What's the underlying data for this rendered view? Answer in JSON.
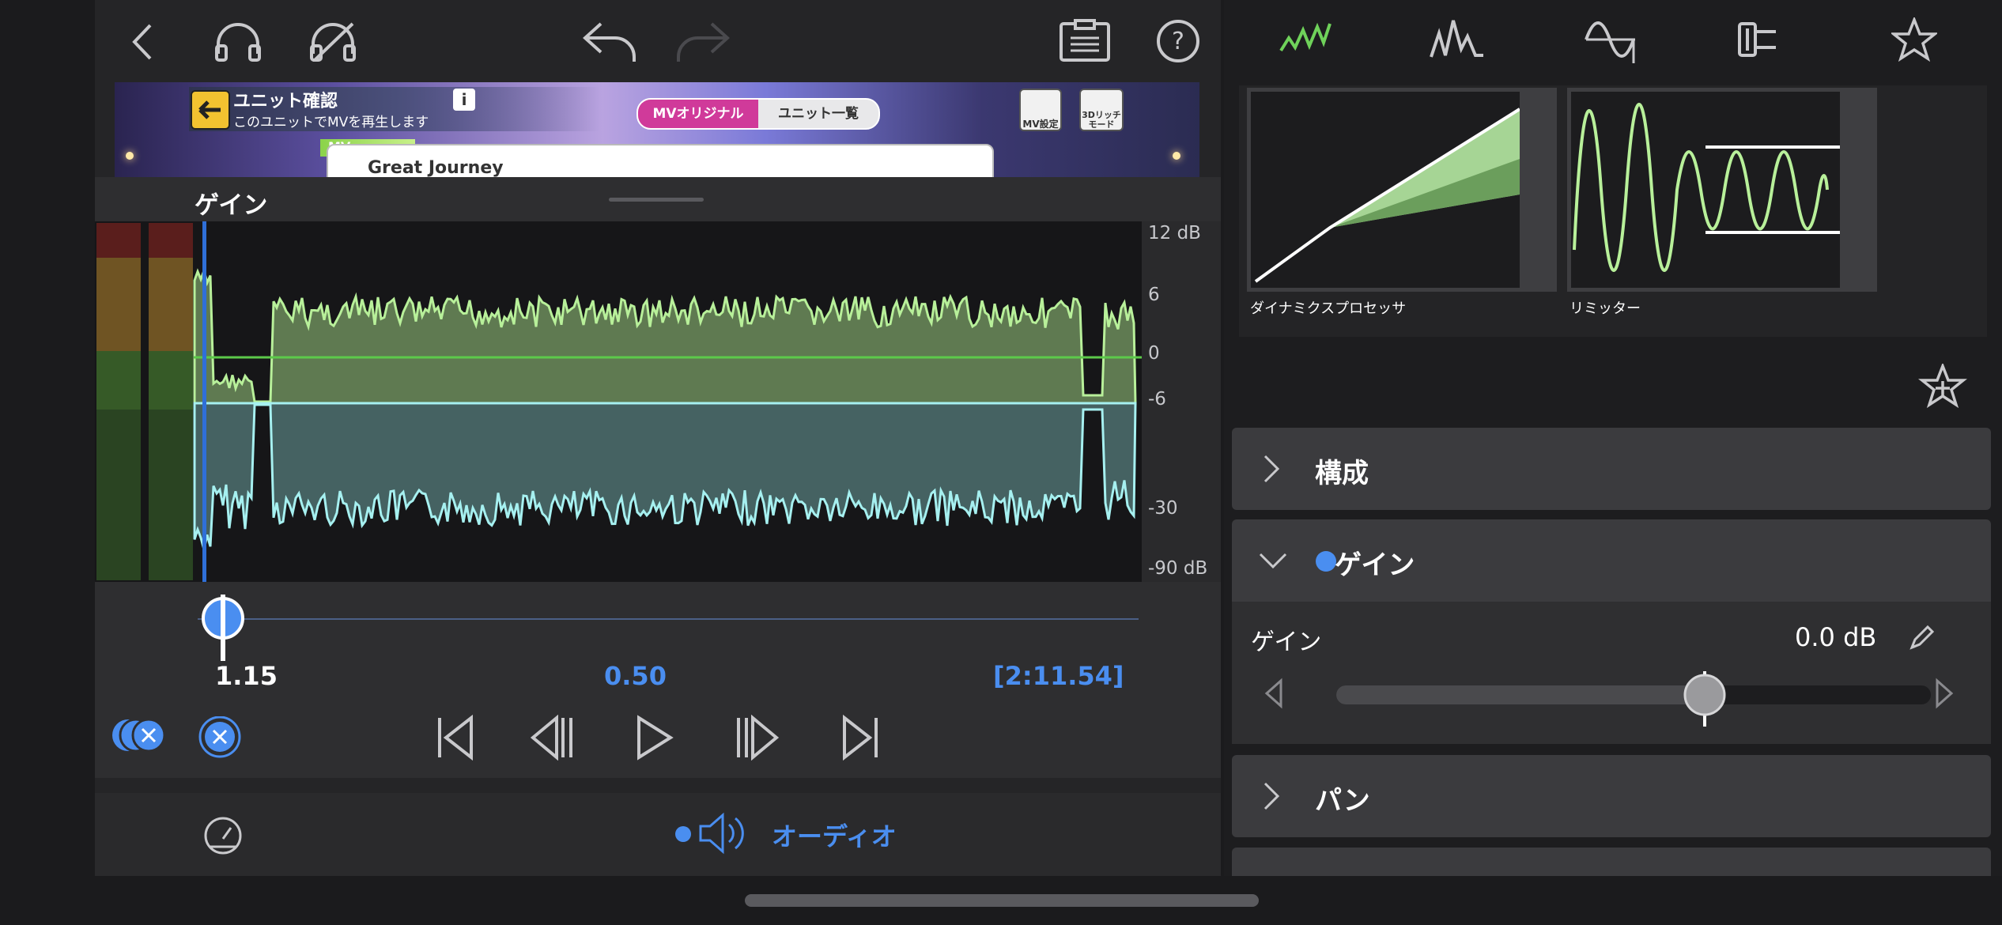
{
  "preview": {
    "title": "ユニット確認",
    "subtitle": "このユニットでMVを再生します",
    "info": "i",
    "tab_original": "MVオリジナル",
    "tab_unit_list": "ユニット一覧",
    "mv_settings": "MV設定",
    "rich_mode": "3Dリッチ\nモード",
    "mv_tag": "MV",
    "song": "Great Journey"
  },
  "panel": {
    "title": "ゲイン",
    "db_scale": [
      "12 dB",
      "6",
      "0",
      "-6",
      "-30",
      "-90 dB"
    ],
    "position_value": "1.15",
    "gain_value": "0.50",
    "duration": "[2:11.54]",
    "playhead_fraction": 0.024
  },
  "bottom": {
    "audio_label": "オーディオ"
  },
  "effects": {
    "items": [
      {
        "label": "ダイナミクスプロセッサ"
      },
      {
        "label": "リミッター"
      }
    ]
  },
  "sections": {
    "composition": "構成",
    "gain": "ゲイン",
    "gain_param_label": "ゲイン",
    "gain_param_value": "0.0 dB",
    "gain_slider_fraction": 0.62,
    "pan": "パン"
  },
  "colors": {
    "accent_blue": "#4a8ef0",
    "wave_green": "#a8e08f",
    "wave_cyan": "#9fe6e6",
    "active_green": "#6fd25a"
  },
  "icons": {
    "back": "chevron-left-icon",
    "headphones": "headphones-icon",
    "headphones_off": "headphones-off-icon",
    "undo": "undo-icon",
    "redo": "redo-icon",
    "clipboard": "clipboard-icon",
    "help": "help-icon"
  }
}
